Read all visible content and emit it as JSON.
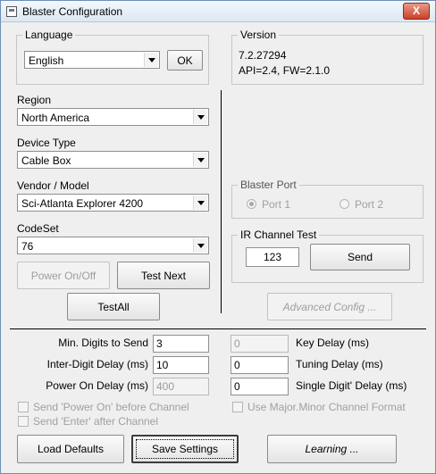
{
  "window": {
    "title": "Blaster Configuration",
    "close_glyph": "X",
    "app_icon": "window-icon"
  },
  "language": {
    "legend": "Language",
    "selected": "English",
    "ok_label": "OK"
  },
  "version": {
    "legend": "Version",
    "number": "7.2.27294",
    "api_fw": "API=2.4, FW=2.1.0"
  },
  "region": {
    "label": "Region",
    "selected": "North America"
  },
  "device_type": {
    "label": "Device Type",
    "selected": "Cable Box"
  },
  "vendor_model": {
    "label": "Vendor / Model",
    "selected": "Sci-Atlanta Explorer 4200"
  },
  "codeset": {
    "label": "CodeSet",
    "selected": "76"
  },
  "buttons": {
    "power_onoff": "Power On/Off",
    "test_next": "Test Next",
    "test_all": "TestAll",
    "advanced_config": "Advanced Config ...",
    "load_defaults": "Load Defaults",
    "save_settings": "Save Settings",
    "learning": "Learning ..."
  },
  "blaster_port": {
    "legend": "Blaster Port",
    "port1": "Port 1",
    "port2": "Port 2",
    "selected": "Port 1"
  },
  "ir_test": {
    "legend": "IR Channel Test",
    "channel": "123",
    "send_label": "Send"
  },
  "settings": {
    "min_digits_label": "Min. Digits to Send",
    "min_digits": "3",
    "inter_digit_label": "Inter-Digit Delay (ms)",
    "inter_digit": "10",
    "power_on_delay_label": "Power On Delay (ms)",
    "power_on_delay": "400",
    "key_delay_label": "Key Delay (ms)",
    "key_delay": "0",
    "tuning_delay_label": "Tuning Delay (ms)",
    "tuning_delay": "0",
    "single_digit_label": "Single Digit' Delay (ms)",
    "single_digit": "0"
  },
  "checks": {
    "send_power_on": "Send 'Power On' before Channel",
    "send_enter": "Send 'Enter' after Channel",
    "major_minor": "Use Major.Minor Channel Format"
  }
}
